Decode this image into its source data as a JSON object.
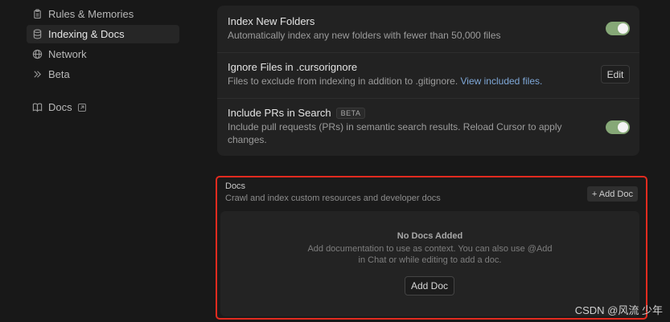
{
  "sidebar": {
    "items": [
      {
        "label": "Rules & Memories",
        "icon": "clipboard-icon"
      },
      {
        "label": "Indexing & Docs",
        "icon": "database-icon",
        "active": true
      },
      {
        "label": "Network",
        "icon": "globe-icon"
      },
      {
        "label": "Beta",
        "icon": "double-chevron-icon"
      }
    ],
    "docs_link": {
      "label": "Docs",
      "icon": "book-icon"
    }
  },
  "settings": {
    "index_new_folders": {
      "title": "Index New Folders",
      "description": "Automatically index any new folders with fewer than 50,000 files",
      "enabled": true
    },
    "ignore_files": {
      "title": "Ignore Files in .cursorignore",
      "description": "Files to exclude from indexing in addition to .gitignore.",
      "link": "View included files.",
      "button": "Edit"
    },
    "include_prs": {
      "title": "Include PRs in Search",
      "badge": "BETA",
      "description_line1": "Include pull requests (PRs) in semantic search results. Reload Cursor to apply",
      "description_line2": "changes.",
      "enabled": true
    }
  },
  "docs": {
    "title": "Docs",
    "description": "Crawl and index custom resources and developer docs",
    "add_button": "+ Add Doc",
    "empty": {
      "title": "No Docs Added",
      "description_line1": "Add documentation to use as context. You can also use @Add",
      "description_line2": "in Chat or while editing to add a doc.",
      "button": "Add Doc"
    }
  },
  "watermark": "CSDN @风流 少年",
  "colors": {
    "toggle_on": "#86a877",
    "highlight_border": "#e32b1f",
    "link": "#7fa8d8"
  }
}
